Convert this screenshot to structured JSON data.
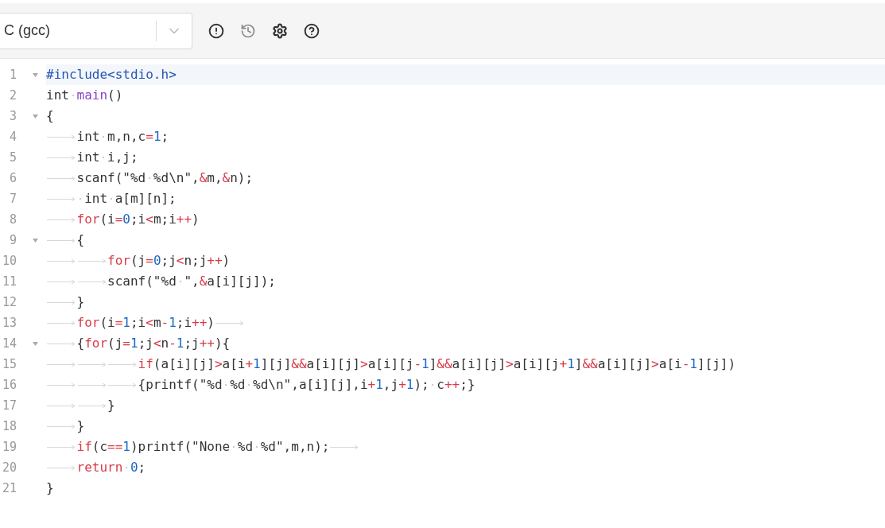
{
  "toolbar": {
    "language": {
      "value": "C (gcc)"
    }
  },
  "lines": [
    {
      "number": "1",
      "foldable": true,
      "active": true,
      "tokens": [
        {
          "kind": "directive",
          "text": "#include<stdio.h>"
        }
      ]
    },
    {
      "number": "2",
      "foldable": false,
      "active": false,
      "tokens": [
        {
          "kind": "plain",
          "text": "int"
        },
        {
          "kind": "space"
        },
        {
          "kind": "function",
          "text": "main"
        },
        {
          "kind": "plain",
          "text": "()"
        }
      ]
    },
    {
      "number": "3",
      "foldable": true,
      "active": false,
      "tokens": [
        {
          "kind": "plain",
          "text": "{"
        }
      ]
    },
    {
      "number": "4",
      "foldable": false,
      "active": false,
      "tokens": [
        {
          "kind": "tab"
        },
        {
          "kind": "plain",
          "text": "int"
        },
        {
          "kind": "space"
        },
        {
          "kind": "plain",
          "text": "m,n,c"
        },
        {
          "kind": "operator",
          "text": "="
        },
        {
          "kind": "number",
          "text": "1"
        },
        {
          "kind": "plain",
          "text": ";"
        }
      ]
    },
    {
      "number": "5",
      "foldable": false,
      "active": false,
      "tokens": [
        {
          "kind": "tab"
        },
        {
          "kind": "plain",
          "text": "int"
        },
        {
          "kind": "space"
        },
        {
          "kind": "plain",
          "text": "i,j;"
        }
      ]
    },
    {
      "number": "6",
      "foldable": false,
      "active": false,
      "tokens": [
        {
          "kind": "tab"
        },
        {
          "kind": "plain",
          "text": "scanf(\"%d"
        },
        {
          "kind": "space"
        },
        {
          "kind": "plain",
          "text": "%d\\n\","
        },
        {
          "kind": "operator",
          "text": "&"
        },
        {
          "kind": "plain",
          "text": "m,"
        },
        {
          "kind": "operator",
          "text": "&"
        },
        {
          "kind": "plain",
          "text": "n);"
        }
      ]
    },
    {
      "number": "7",
      "foldable": false,
      "active": false,
      "tokens": [
        {
          "kind": "tab"
        },
        {
          "kind": "space"
        },
        {
          "kind": "plain",
          "text": "int"
        },
        {
          "kind": "space"
        },
        {
          "kind": "plain",
          "text": "a[m][n];"
        }
      ]
    },
    {
      "number": "8",
      "foldable": false,
      "active": false,
      "tokens": [
        {
          "kind": "tab"
        },
        {
          "kind": "keyword",
          "text": "for"
        },
        {
          "kind": "plain",
          "text": "(i"
        },
        {
          "kind": "operator",
          "text": "="
        },
        {
          "kind": "number",
          "text": "0"
        },
        {
          "kind": "plain",
          "text": ";i"
        },
        {
          "kind": "operator",
          "text": "<"
        },
        {
          "kind": "plain",
          "text": "m;i"
        },
        {
          "kind": "operator",
          "text": "++"
        },
        {
          "kind": "plain",
          "text": ")"
        }
      ]
    },
    {
      "number": "9",
      "foldable": true,
      "active": false,
      "tokens": [
        {
          "kind": "tab"
        },
        {
          "kind": "plain",
          "text": "{"
        }
      ]
    },
    {
      "number": "10",
      "foldable": false,
      "active": false,
      "tokens": [
        {
          "kind": "tab"
        },
        {
          "kind": "tab"
        },
        {
          "kind": "keyword",
          "text": "for"
        },
        {
          "kind": "plain",
          "text": "(j"
        },
        {
          "kind": "operator",
          "text": "="
        },
        {
          "kind": "number",
          "text": "0"
        },
        {
          "kind": "plain",
          "text": ";j"
        },
        {
          "kind": "operator",
          "text": "<"
        },
        {
          "kind": "plain",
          "text": "n;j"
        },
        {
          "kind": "operator",
          "text": "++"
        },
        {
          "kind": "plain",
          "text": ")"
        }
      ]
    },
    {
      "number": "11",
      "foldable": false,
      "active": false,
      "tokens": [
        {
          "kind": "tab"
        },
        {
          "kind": "tab"
        },
        {
          "kind": "plain",
          "text": "scanf(\"%d"
        },
        {
          "kind": "space"
        },
        {
          "kind": "plain",
          "text": "\","
        },
        {
          "kind": "operator",
          "text": "&"
        },
        {
          "kind": "plain",
          "text": "a[i][j]);"
        }
      ]
    },
    {
      "number": "12",
      "foldable": false,
      "active": false,
      "tokens": [
        {
          "kind": "tab"
        },
        {
          "kind": "plain",
          "text": "}"
        }
      ]
    },
    {
      "number": "13",
      "foldable": false,
      "active": false,
      "tokens": [
        {
          "kind": "tab"
        },
        {
          "kind": "keyword",
          "text": "for"
        },
        {
          "kind": "plain",
          "text": "(i"
        },
        {
          "kind": "operator",
          "text": "="
        },
        {
          "kind": "number",
          "text": "1"
        },
        {
          "kind": "plain",
          "text": ";i"
        },
        {
          "kind": "operator",
          "text": "<"
        },
        {
          "kind": "plain",
          "text": "m"
        },
        {
          "kind": "operator",
          "text": "-"
        },
        {
          "kind": "number",
          "text": "1"
        },
        {
          "kind": "plain",
          "text": ";i"
        },
        {
          "kind": "operator",
          "text": "++"
        },
        {
          "kind": "plain",
          "text": ")"
        },
        {
          "kind": "tab"
        }
      ]
    },
    {
      "number": "14",
      "foldable": true,
      "active": false,
      "tokens": [
        {
          "kind": "tab"
        },
        {
          "kind": "plain",
          "text": "{"
        },
        {
          "kind": "keyword",
          "text": "for"
        },
        {
          "kind": "plain",
          "text": "(j"
        },
        {
          "kind": "operator",
          "text": "="
        },
        {
          "kind": "number",
          "text": "1"
        },
        {
          "kind": "plain",
          "text": ";j"
        },
        {
          "kind": "operator",
          "text": "<"
        },
        {
          "kind": "plain",
          "text": "n"
        },
        {
          "kind": "operator",
          "text": "-"
        },
        {
          "kind": "number",
          "text": "1"
        },
        {
          "kind": "plain",
          "text": ";j"
        },
        {
          "kind": "operator",
          "text": "++"
        },
        {
          "kind": "plain",
          "text": "){"
        }
      ]
    },
    {
      "number": "15",
      "foldable": false,
      "active": false,
      "tokens": [
        {
          "kind": "tab"
        },
        {
          "kind": "tab"
        },
        {
          "kind": "tab"
        },
        {
          "kind": "keyword",
          "text": "if"
        },
        {
          "kind": "plain",
          "text": "(a[i][j]"
        },
        {
          "kind": "operator",
          "text": ">"
        },
        {
          "kind": "plain",
          "text": "a[i"
        },
        {
          "kind": "operator",
          "text": "+"
        },
        {
          "kind": "number",
          "text": "1"
        },
        {
          "kind": "plain",
          "text": "][j]"
        },
        {
          "kind": "operator",
          "text": "&&"
        },
        {
          "kind": "plain",
          "text": "a[i][j]"
        },
        {
          "kind": "operator",
          "text": ">"
        },
        {
          "kind": "plain",
          "text": "a[i][j"
        },
        {
          "kind": "operator",
          "text": "-"
        },
        {
          "kind": "number",
          "text": "1"
        },
        {
          "kind": "plain",
          "text": "]"
        },
        {
          "kind": "operator",
          "text": "&&"
        },
        {
          "kind": "plain",
          "text": "a[i][j]"
        },
        {
          "kind": "operator",
          "text": ">"
        },
        {
          "kind": "plain",
          "text": "a[i][j"
        },
        {
          "kind": "operator",
          "text": "+"
        },
        {
          "kind": "number",
          "text": "1"
        },
        {
          "kind": "plain",
          "text": "]"
        },
        {
          "kind": "operator",
          "text": "&&"
        },
        {
          "kind": "plain",
          "text": "a[i][j]"
        },
        {
          "kind": "operator",
          "text": ">"
        },
        {
          "kind": "plain",
          "text": "a[i"
        },
        {
          "kind": "operator",
          "text": "-"
        },
        {
          "kind": "number",
          "text": "1"
        },
        {
          "kind": "plain",
          "text": "][j])"
        }
      ]
    },
    {
      "number": "16",
      "foldable": false,
      "active": false,
      "tokens": [
        {
          "kind": "tab"
        },
        {
          "kind": "tab"
        },
        {
          "kind": "tab"
        },
        {
          "kind": "plain",
          "text": "{printf(\"%d"
        },
        {
          "kind": "space"
        },
        {
          "kind": "plain",
          "text": "%d"
        },
        {
          "kind": "space"
        },
        {
          "kind": "plain",
          "text": "%d\\n\",a[i][j],i"
        },
        {
          "kind": "operator",
          "text": "+"
        },
        {
          "kind": "number",
          "text": "1"
        },
        {
          "kind": "plain",
          "text": ",j"
        },
        {
          "kind": "operator",
          "text": "+"
        },
        {
          "kind": "number",
          "text": "1"
        },
        {
          "kind": "plain",
          "text": ");"
        },
        {
          "kind": "space"
        },
        {
          "kind": "plain",
          "text": "c"
        },
        {
          "kind": "operator",
          "text": "++"
        },
        {
          "kind": "plain",
          "text": ";}"
        }
      ]
    },
    {
      "number": "17",
      "foldable": false,
      "active": false,
      "tokens": [
        {
          "kind": "tab"
        },
        {
          "kind": "tab"
        },
        {
          "kind": "plain",
          "text": "}"
        }
      ]
    },
    {
      "number": "18",
      "foldable": false,
      "active": false,
      "tokens": [
        {
          "kind": "tab"
        },
        {
          "kind": "plain",
          "text": "}"
        }
      ]
    },
    {
      "number": "19",
      "foldable": false,
      "active": false,
      "tokens": [
        {
          "kind": "tab"
        },
        {
          "kind": "keyword",
          "text": "if"
        },
        {
          "kind": "plain",
          "text": "(c"
        },
        {
          "kind": "operator",
          "text": "=="
        },
        {
          "kind": "number",
          "text": "1"
        },
        {
          "kind": "plain",
          "text": ")printf(\"None"
        },
        {
          "kind": "space"
        },
        {
          "kind": "plain",
          "text": "%d"
        },
        {
          "kind": "space"
        },
        {
          "kind": "plain",
          "text": "%d\",m,n);"
        },
        {
          "kind": "tab"
        }
      ]
    },
    {
      "number": "20",
      "foldable": false,
      "active": false,
      "tokens": [
        {
          "kind": "tab"
        },
        {
          "kind": "keyword",
          "text": "return"
        },
        {
          "kind": "space"
        },
        {
          "kind": "number",
          "text": "0"
        },
        {
          "kind": "plain",
          "text": ";"
        }
      ]
    },
    {
      "number": "21",
      "foldable": false,
      "active": false,
      "tokens": [
        {
          "kind": "plain",
          "text": "}"
        }
      ]
    }
  ]
}
